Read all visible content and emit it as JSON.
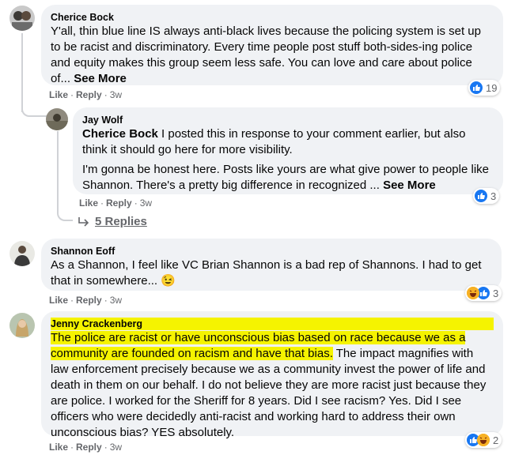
{
  "comments": [
    {
      "author": "Cherice Bock",
      "text": "Y'all, thin blue line IS always anti-black lives because the policing system is set up to be racist and discriminatory. Every time people post stuff both-sides-ing police and equity makes this group seem less safe. You can love and care about police of...",
      "see_more": "See More",
      "actions": {
        "like": "Like",
        "reply": "Reply",
        "time": "3w"
      },
      "reactions": {
        "count": "19"
      }
    },
    {
      "author": "Jay Wolf",
      "mention": "Cherice Bock",
      "text1": " I posted this in response to your comment earlier, but also think it should go here for more visibility.",
      "text2": "I'm gonna be honest here. Posts like yours are what give power to people like Shannon. There's a pretty big difference in recognized ...",
      "see_more": "See More",
      "actions": {
        "like": "Like",
        "reply": "Reply",
        "time": "3w"
      },
      "reactions": {
        "count": "3"
      }
    },
    {
      "replies_label": "5 Replies"
    },
    {
      "author": "Shannon Eoff",
      "text": "As a Shannon, I feel like VC Brian Shannon is a bad rep of Shannons. I had to get that in somewhere...",
      "emoji": "😉",
      "actions": {
        "like": "Like",
        "reply": "Reply",
        "time": "3w"
      },
      "reactions": {
        "count": "3"
      }
    },
    {
      "author": "Jenny Crackenberg",
      "highlighted_text": "The police are racist or have unconscious bias based on race because we as a community are founded on racism and have that bias.",
      "text": " The impact magnifies with law enforcement precisely because we as a community invest the power of life and death in them on our behalf. I do not believe they are more racist just because they are police. I worked for the Sheriff for 8 years. Did I see racism? Yes. Did I see officers who were decidedly anti-racist and working hard to address their own unconscious bias? YES absolutely.",
      "actions": {
        "like": "Like",
        "reply": "Reply",
        "time": "3w"
      },
      "reactions": {
        "count": "2"
      }
    }
  ],
  "colors": {
    "bubble": "#f0f2f5",
    "like_blue": "#1877f2",
    "muted_text": "#65676b",
    "highlight": "#f5f300"
  }
}
